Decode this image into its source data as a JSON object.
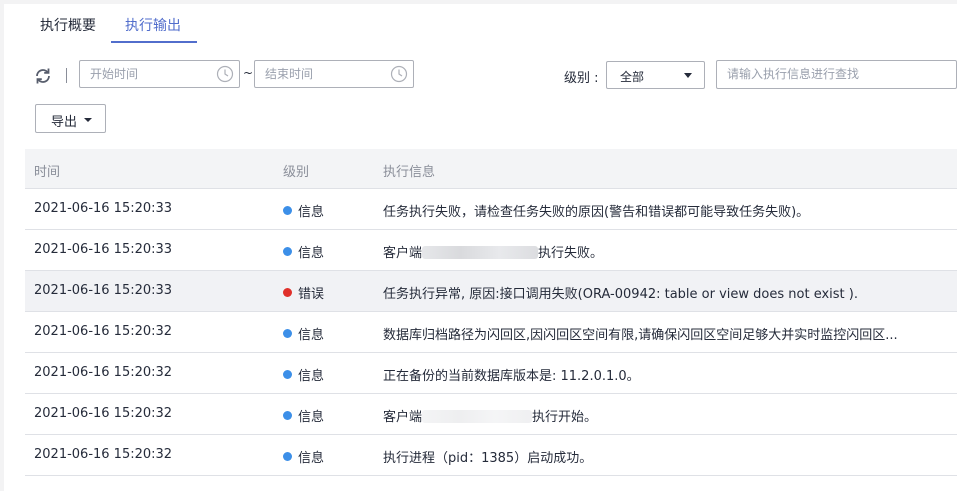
{
  "tabs": [
    {
      "label": "执行概要",
      "active": false
    },
    {
      "label": "执行输出",
      "active": true
    }
  ],
  "toolbar": {
    "start_placeholder": "开始时间",
    "end_placeholder": "结束时间",
    "separator": "~",
    "level_label": "级别 :",
    "level_value": "全部",
    "search_placeholder": "请输入执行信息进行查找",
    "export_label": "导出"
  },
  "colors": {
    "accent": "#526ecc",
    "info": "#3c8fe8",
    "error": "#e0302a"
  },
  "table": {
    "headers": [
      "时间",
      "级别",
      "执行信息"
    ],
    "rows": [
      {
        "time": "2021-06-16 15:20:33",
        "level": "信息",
        "type": "info",
        "message": "任务执行失败，请检查任务失败的原因(警告和错误都可能导致任务失败)。"
      },
      {
        "time": "2021-06-16 15:20:33",
        "level": "信息",
        "type": "info",
        "message_prefix": "客户端",
        "message_suffix": "执行失败。"
      },
      {
        "time": "2021-06-16 15:20:33",
        "level": "错误",
        "type": "error",
        "message": "任务执行异常, 原因:接口调用失败(ORA-00942: table or view does not exist )."
      },
      {
        "time": "2021-06-16 15:20:32",
        "level": "信息",
        "type": "info",
        "message": "数据库归档路径为闪回区,因闪回区空间有限,请确保闪回区空间足够大并实时监控闪回区..."
      },
      {
        "time": "2021-06-16 15:20:32",
        "level": "信息",
        "type": "info",
        "message": "正在备份的当前数据库版本是: 11.2.0.1.0。"
      },
      {
        "time": "2021-06-16 15:20:32",
        "level": "信息",
        "type": "info",
        "message_prefix": "客户端",
        "message_suffix": "执行开始。"
      },
      {
        "time": "2021-06-16 15:20:32",
        "level": "信息",
        "type": "info",
        "message": "执行进程（pid：1385）启动成功。"
      }
    ]
  }
}
